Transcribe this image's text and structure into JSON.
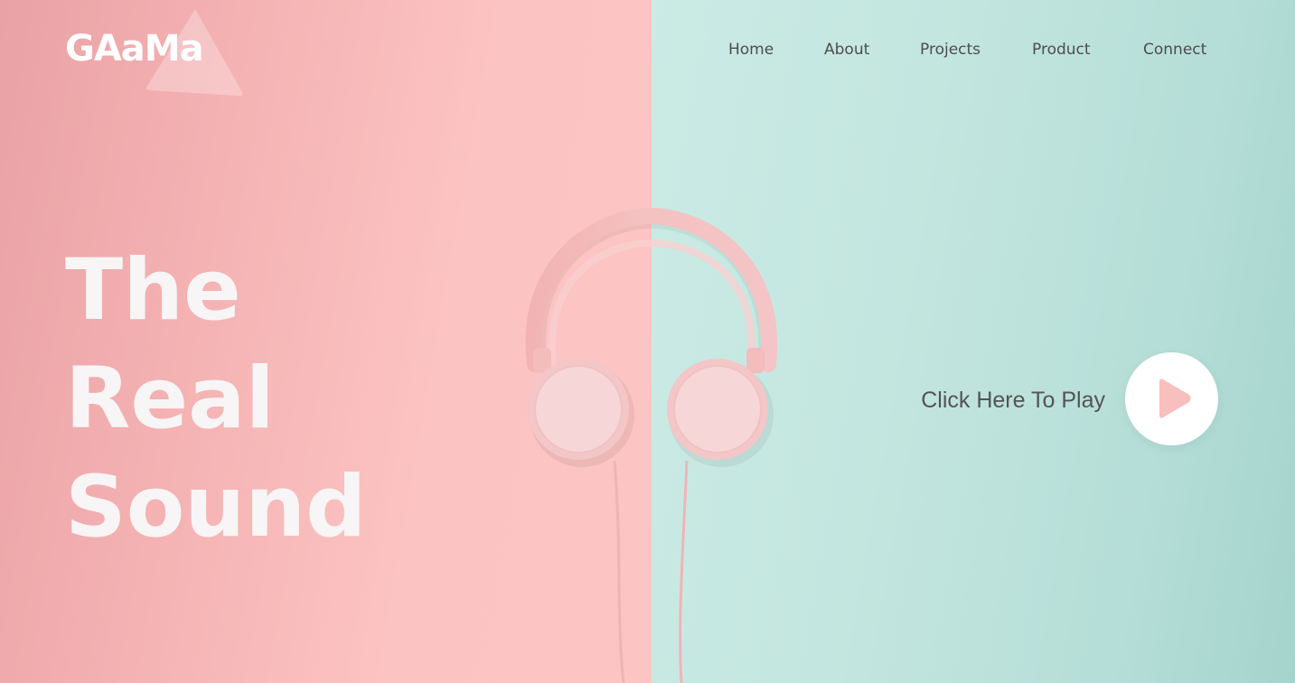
{
  "brand": {
    "logo": "GAaMa"
  },
  "nav": {
    "items": [
      {
        "label": "Home"
      },
      {
        "label": "About"
      },
      {
        "label": "Projects"
      },
      {
        "label": "Product"
      },
      {
        "label": "Connect"
      }
    ]
  },
  "hero": {
    "headline": [
      "The",
      "Real",
      "Sound"
    ],
    "play_label": "Click Here To Play",
    "play_icon": "play-triangle-icon",
    "image": "pink-headphones-illustration"
  },
  "colors": {
    "left_background": "#fbc3c1",
    "right_background": "#c3e6df",
    "headline": "#f7f5f5",
    "nav_text": "#4d4d4d",
    "play_icon": "#f7c0bf"
  }
}
